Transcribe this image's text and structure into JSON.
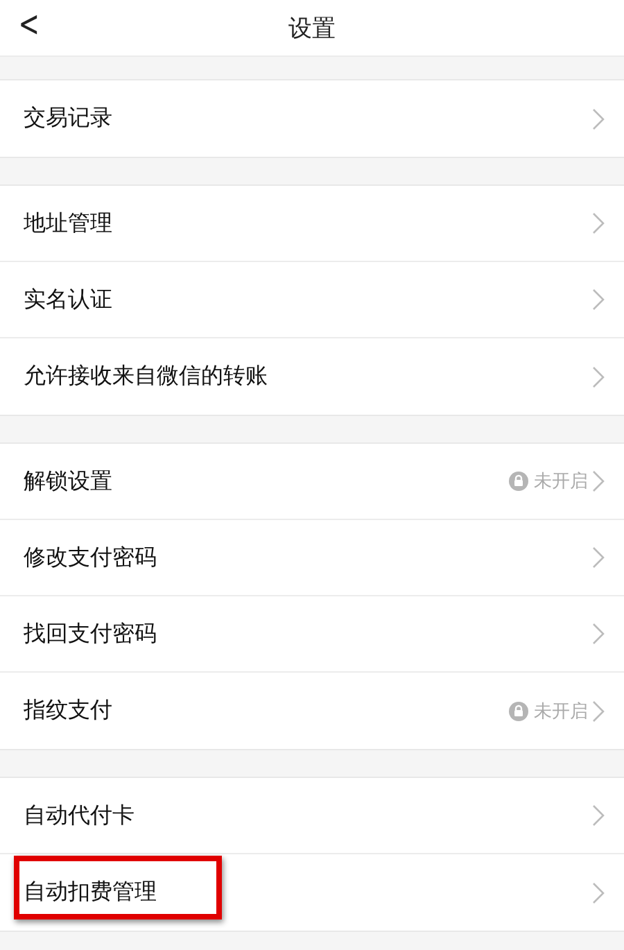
{
  "header": {
    "back": "<",
    "title": "设置"
  },
  "groups": [
    {
      "items": [
        {
          "label": "交易记录",
          "highlighted": false
        }
      ]
    },
    {
      "items": [
        {
          "label": "地址管理",
          "highlighted": false
        },
        {
          "label": "实名认证",
          "highlighted": false
        },
        {
          "label": "允许接收来自微信的转账",
          "highlighted": false
        }
      ]
    },
    {
      "items": [
        {
          "label": "解锁设置",
          "status": "未开启",
          "highlighted": false
        },
        {
          "label": "修改支付密码",
          "highlighted": false
        },
        {
          "label": "找回支付密码",
          "highlighted": false
        },
        {
          "label": "指纹支付",
          "status": "未开启",
          "highlighted": false
        }
      ]
    },
    {
      "items": [
        {
          "label": "自动代付卡",
          "highlighted": false
        },
        {
          "label": "自动扣费管理",
          "highlighted": true
        }
      ]
    }
  ]
}
